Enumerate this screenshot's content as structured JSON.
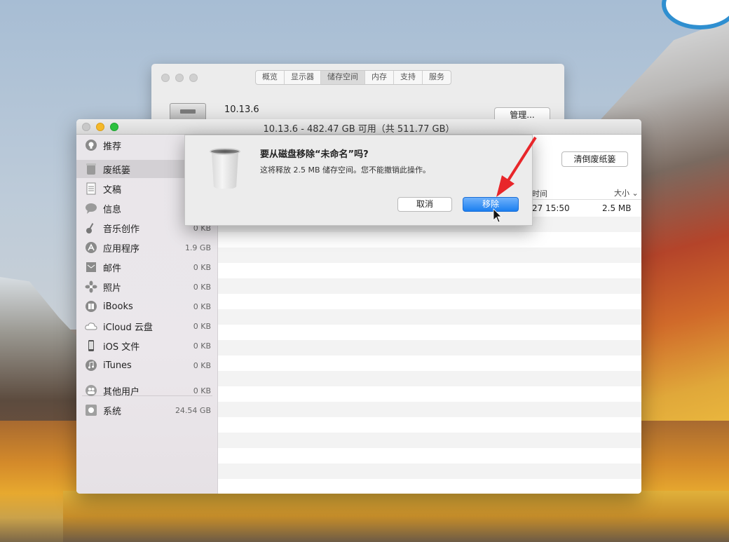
{
  "back_window": {
    "tabs": [
      "概览",
      "显示器",
      "储存空间",
      "内存",
      "支持",
      "服务"
    ],
    "active_tab": "储存空间",
    "version": "10.13.6",
    "manage_label": "管理..."
  },
  "main_window": {
    "title": "10.13.6 - 482.47 GB 可用（共 511.77 GB）",
    "empty_trash_label": "清倒废纸篓",
    "columns": {
      "time": "时间",
      "size": "大小 ⌄"
    },
    "row": {
      "time": "27 15:50",
      "size": "2.5 MB"
    }
  },
  "sidebar": {
    "items": [
      {
        "label": "推荐",
        "size": "",
        "icon": "lightbulb-icon"
      },
      {
        "label": "废纸篓",
        "size": "",
        "icon": "trash-icon"
      },
      {
        "label": "文稿",
        "size": "",
        "icon": "document-icon"
      },
      {
        "label": "信息",
        "size": "",
        "icon": "message-icon"
      },
      {
        "label": "音乐创作",
        "size": "0 KB",
        "icon": "guitar-icon"
      },
      {
        "label": "应用程序",
        "size": "1.9 GB",
        "icon": "app-store-icon"
      },
      {
        "label": "邮件",
        "size": "0 KB",
        "icon": "mail-icon"
      },
      {
        "label": "照片",
        "size": "0 KB",
        "icon": "photos-icon"
      },
      {
        "label": "iBooks",
        "size": "0 KB",
        "icon": "book-icon"
      },
      {
        "label": "iCloud 云盘",
        "size": "0 KB",
        "icon": "cloud-icon"
      },
      {
        "label": "iOS 文件",
        "size": "0 KB",
        "icon": "phone-icon"
      },
      {
        "label": "iTunes",
        "size": "0 KB",
        "icon": "music-icon"
      },
      {
        "label": "其他用户",
        "size": "0 KB",
        "icon": "users-icon"
      },
      {
        "label": "系统",
        "size": "24.54 GB",
        "icon": "disk-icon"
      }
    ],
    "selected": "废纸篓"
  },
  "dialog": {
    "title": "要从磁盘移除“未命名”吗?",
    "message": "这将释放 2.5 MB 储存空间。您不能撤销此操作。",
    "cancel_label": "取消",
    "remove_label": "移除"
  },
  "colors": {
    "accent_blue": "#1b7ff0",
    "annotation_red": "#e8262a"
  }
}
